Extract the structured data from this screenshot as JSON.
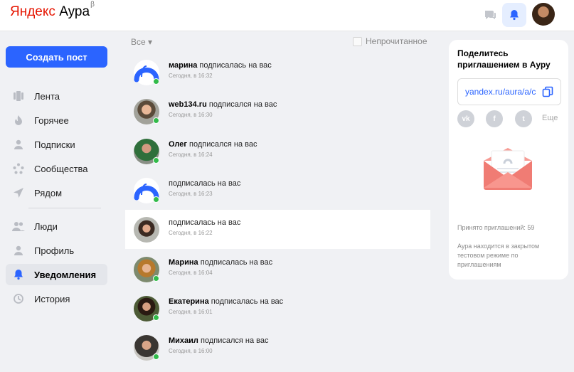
{
  "header": {
    "logo_yandex": "Яндекс",
    "logo_aura": "Аура",
    "logo_beta": "β",
    "icons": [
      "chat-icon",
      "bell-icon"
    ]
  },
  "sidebar": {
    "create_label": "Создать пост",
    "items": [
      {
        "label": "Лента",
        "icon": "feed-icon"
      },
      {
        "label": "Горячее",
        "icon": "flame-icon"
      },
      {
        "label": "Подписки",
        "icon": "person-icon"
      },
      {
        "label": "Сообщества",
        "icon": "communities-icon"
      },
      {
        "label": "Рядом",
        "icon": "nearby-icon"
      },
      {
        "label": "Люди",
        "icon": "people-icon"
      },
      {
        "label": "Профиль",
        "icon": "profile-icon"
      },
      {
        "label": "Уведомления",
        "icon": "bell-icon"
      },
      {
        "label": "История",
        "icon": "history-icon"
      }
    ]
  },
  "feed": {
    "filter_label": "Все",
    "unread_label": "Непрочитанное",
    "rows": [
      {
        "name": "марина",
        "action": "подписалась на вас",
        "time": "Сегодня, в 16:32"
      },
      {
        "name": "web134.ru",
        "action": "подписался на вас",
        "time": "Сегодня, в 16:30"
      },
      {
        "name": "Олег",
        "action": "подписался на вас",
        "time": "Сегодня, в 16:24"
      },
      {
        "name": "",
        "action": "подписалась на вас",
        "time": "Сегодня, в 16:23"
      },
      {
        "name": "",
        "action": "подписалась на вас",
        "time": "Сегодня, в 16:22"
      },
      {
        "name": "Марина",
        "action": "подписалась на вас",
        "time": "Сегодня, в 16:04"
      },
      {
        "name": "Екатерина",
        "action": "подписалась на вас",
        "time": "Сегодня, в 16:01"
      },
      {
        "name": "Михаил",
        "action": "подписался на вас",
        "time": "Сегодня, в 16:00"
      }
    ]
  },
  "invite": {
    "title": "Поделитесь приглашением в Ауру",
    "link": "yandex.ru/aura/a/c",
    "social": [
      "vk",
      "f",
      "t"
    ],
    "more": "Еще",
    "accepted": "Принято приглашений: 59",
    "note": "Аура находится в закрытом тестовом режиме по приглашениям"
  },
  "colors": {
    "accent": "#2b64ff",
    "online": "#32bb4a",
    "brand_red": "#e61400"
  }
}
